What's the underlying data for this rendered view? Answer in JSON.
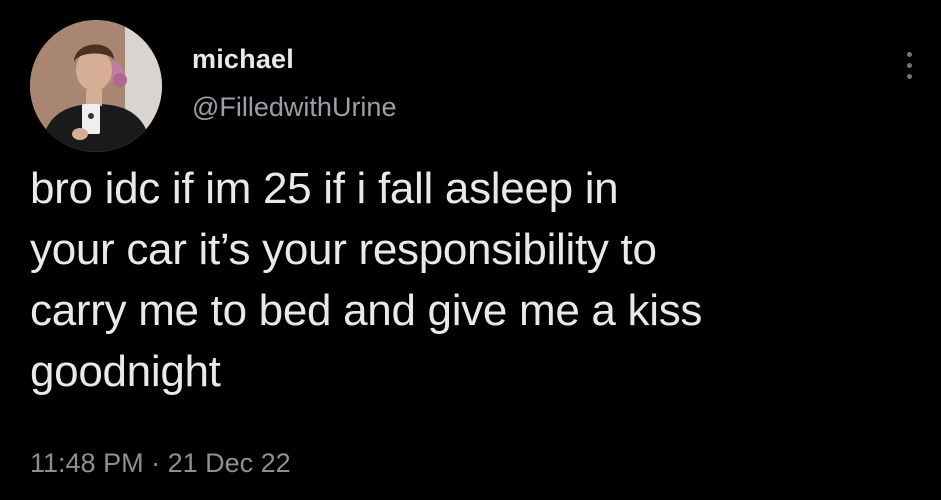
{
  "tweet": {
    "author": {
      "display_name": "michael",
      "handle": "@FilledwithUrine",
      "avatar_icon": "profile-photo-avatar"
    },
    "more_icon": "more-vertical-icon",
    "text": "bro idc if im 25 if i fall asleep in\nyour car it’s your responsibility to\ncarry me to bed and give me a kiss\ngoodnight",
    "time": "11:48 PM",
    "separator": "·",
    "date": "21 Dec 22"
  },
  "colors": {
    "background": "#000000",
    "primary_text": "#e7e9ea",
    "secondary_text": "#8b9095"
  }
}
